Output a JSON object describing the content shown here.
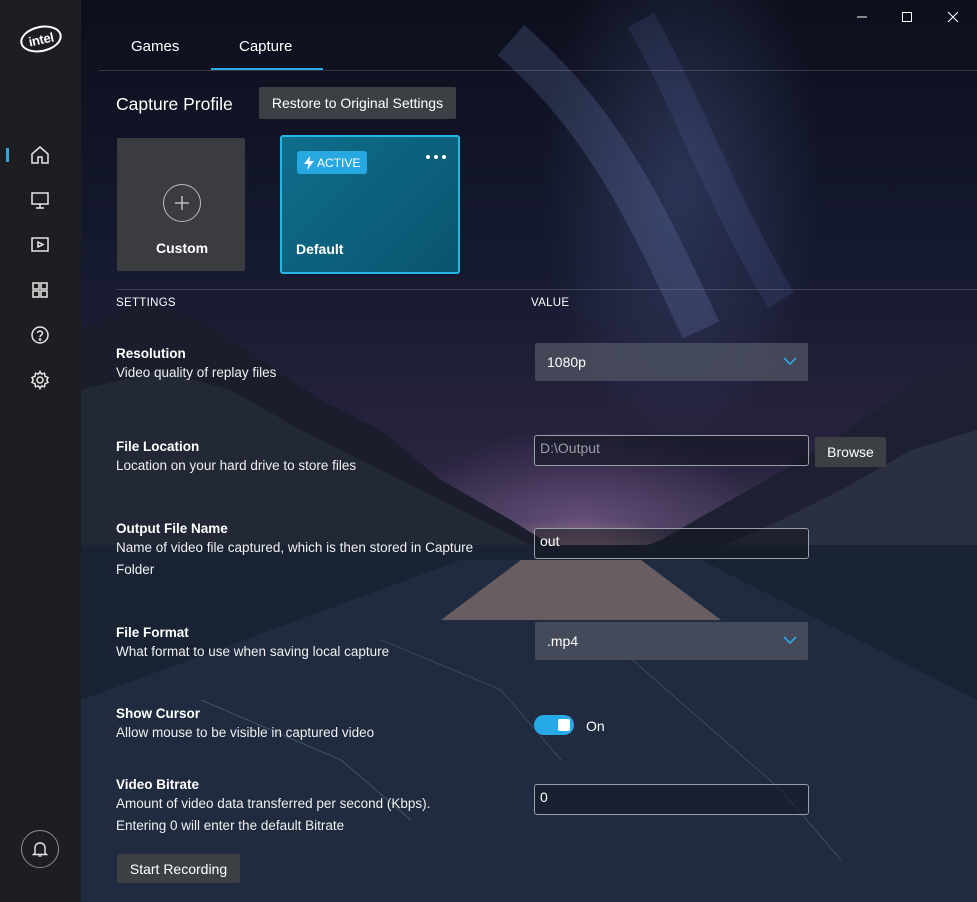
{
  "brand": {
    "logo_text": "intel"
  },
  "tabs": [
    {
      "label": "Games",
      "active": false
    },
    {
      "label": "Capture",
      "active": true
    }
  ],
  "sidebar": {
    "items": [
      {
        "icon": "home-icon",
        "active": true
      },
      {
        "icon": "monitor-icon",
        "active": false
      },
      {
        "icon": "media-icon",
        "active": false
      },
      {
        "icon": "apps-grid-icon",
        "active": false
      },
      {
        "icon": "help-icon",
        "active": false
      },
      {
        "icon": "gear-icon",
        "active": false
      }
    ],
    "bottom_icon": "bell-icon"
  },
  "capture_profile": {
    "title": "Capture Profile",
    "restore_label": "Restore to Original Settings",
    "cards": [
      {
        "label": "Custom",
        "icon": "plus-icon"
      },
      {
        "label": "Default",
        "badge": "ACTIVE",
        "badge_icon": "lightning-icon",
        "menu_icon": "more-dots-icon"
      }
    ]
  },
  "table_headers": {
    "settings": "SETTINGS",
    "value": "VALUE"
  },
  "settings": {
    "resolution": {
      "title": "Resolution",
      "desc": "Video quality of replay files",
      "value": "1080p"
    },
    "file_location": {
      "title": "File Location",
      "desc": "Location on your hard drive to store files",
      "placeholder": "D:\\Output",
      "browse_label": "Browse"
    },
    "output_file_name": {
      "title": "Output File Name",
      "desc": "Name of video file captured, which is then stored in Capture Folder",
      "value": "out"
    },
    "file_format": {
      "title": "File Format",
      "desc": "What format to use when saving local capture",
      "value": ".mp4"
    },
    "show_cursor": {
      "title": "Show Cursor",
      "desc": "Allow mouse to be visible in captured video",
      "state": "On",
      "enabled": true
    },
    "video_bitrate": {
      "title": "Video Bitrate",
      "desc_line1": "Amount of video data transferred per second (Kbps).",
      "desc_line2": "Entering 0 will enter the default Bitrate",
      "value": "0"
    }
  },
  "start_recording_label": "Start Recording",
  "colors": {
    "accent": "#2fa8e0",
    "sidebar_bg": "#1c1e22",
    "button_bg": "#3c3f44",
    "active_card": "#0e6e8a"
  }
}
